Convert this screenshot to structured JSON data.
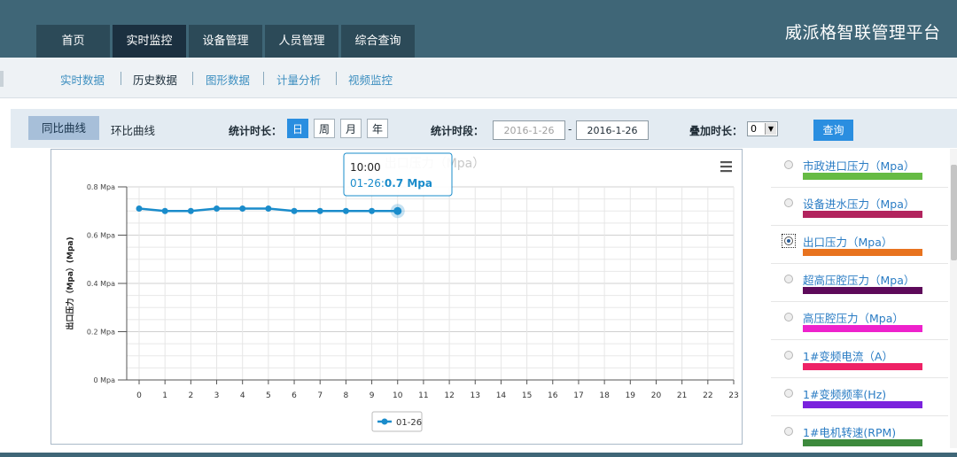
{
  "brand": "威派格智联管理平台",
  "nav": [
    {
      "label": "首页",
      "active": false
    },
    {
      "label": "实时监控",
      "active": true
    },
    {
      "label": "设备管理",
      "active": false
    },
    {
      "label": "人员管理",
      "active": false
    },
    {
      "label": "综合查询",
      "active": false
    }
  ],
  "subnav": [
    {
      "label": "实时数据",
      "active": false
    },
    {
      "label": "历史数据",
      "active": true
    },
    {
      "label": "图形数据",
      "active": false
    },
    {
      "label": "计量分析",
      "active": false
    },
    {
      "label": "视频监控",
      "active": false
    }
  ],
  "toolbar": {
    "compare_yoy": "同比曲线",
    "compare_mom": "环比曲线",
    "duration_label": "统计时长：",
    "duration_options": [
      "日",
      "周",
      "月",
      "年"
    ],
    "duration_selected": "日",
    "period_label": "统计时段：",
    "start_date": "2016-1-26",
    "dash": "-",
    "end_date": "2016-1-26",
    "overlay_label": "叠加时长：",
    "overlay_value": "0",
    "query_label": "查询"
  },
  "chart_data": {
    "type": "line",
    "title": "出口压力（Mpa）",
    "ylabel": "出口压力（Mpa）(Mpa)",
    "x": [
      0,
      1,
      2,
      3,
      4,
      5,
      6,
      7,
      8,
      9,
      10
    ],
    "x_ticks": [
      "0",
      "1",
      "2",
      "3",
      "4",
      "5",
      "6",
      "7",
      "8",
      "9",
      "10",
      "11",
      "12",
      "13",
      "14",
      "15",
      "16",
      "17",
      "18",
      "19",
      "20",
      "21",
      "22",
      "23"
    ],
    "xlim": [
      0,
      23
    ],
    "y_ticks": [
      "0 Mpa",
      "0.2 Mpa",
      "0.4 Mpa",
      "0.6 Mpa",
      "0.8 Mpa"
    ],
    "ylim": [
      0,
      0.8
    ],
    "grid": true,
    "series": [
      {
        "name": "01-26",
        "color": "#1a8ccb",
        "values": [
          0.71,
          0.7,
          0.7,
          0.71,
          0.71,
          0.71,
          0.7,
          0.7,
          0.7,
          0.7,
          0.7
        ]
      }
    ],
    "tooltip": {
      "time": "10:00",
      "series": "01-26",
      "value": "0.7 Mpa"
    },
    "menu_icon": "hamburger-icon"
  },
  "legend": [
    {
      "label": "市政进口压力（Mpa）",
      "color": "#66bb44",
      "selected": false
    },
    {
      "label": "设备进水压力（Mpa）",
      "color": "#b2245e",
      "selected": false
    },
    {
      "label": "出口压力（Mpa）",
      "color": "#e8731f",
      "selected": true
    },
    {
      "label": "超高压腔压力（Mpa）",
      "color": "#5d0a5a",
      "selected": false
    },
    {
      "label": "高压腔压力（Mpa）",
      "color": "#ee22cc",
      "selected": false
    },
    {
      "label": "1#变频电流（A）",
      "color": "#ee2266",
      "selected": false
    },
    {
      "label": "1#变频频率(Hz)",
      "color": "#7a22dd",
      "selected": false
    },
    {
      "label": "1#电机转速(RPM)",
      "color": "#3d8a3d",
      "selected": false
    }
  ]
}
